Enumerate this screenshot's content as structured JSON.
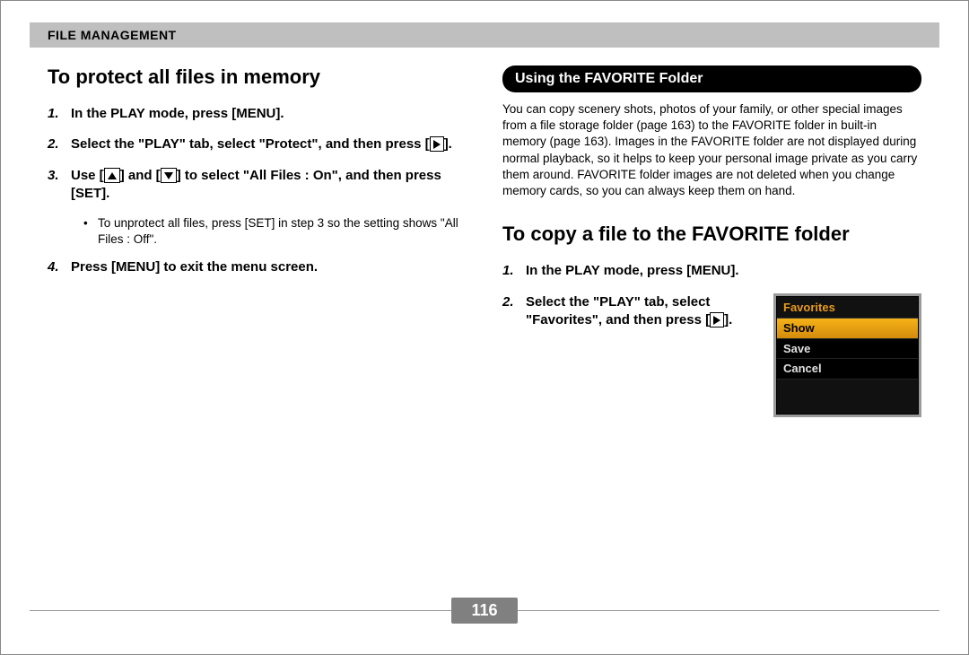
{
  "header": {
    "section": "File Management"
  },
  "left": {
    "heading": "To protect all files in memory",
    "steps": {
      "s1": "In the PLAY mode, press [MENU].",
      "s2_a": "Select the \"PLAY\" tab, select \"Protect\", and then press [",
      "s2_b": "].",
      "s3_a": "Use [",
      "s3_b": "] and [",
      "s3_c": "] to select \"All Files : On\", and then press [SET].",
      "bullet": "To unprotect all files, press [SET] in step 3 so the setting shows \"All Files : Off\".",
      "s4": "Press [MENU] to exit the menu screen."
    }
  },
  "right": {
    "pill": "Using the FAVORITE Folder",
    "intro": "You can copy scenery shots, photos of your family, or other special images from a file storage folder (page 163) to the FAVORITE folder in built-in memory (page 163). Images in the FAVORITE folder are not displayed during normal playback, so it helps to keep your personal image private as you carry them around. FAVORITE folder images are not deleted when you change memory cards, so you can always keep them on hand.",
    "heading2": "To copy a file to the FAVORITE folder",
    "steps": {
      "s1": "In the PLAY mode, press [MENU].",
      "s2_a": "Select the \"PLAY\" tab, select \"Favorites\", and then press [",
      "s2_b": "]."
    },
    "menu": {
      "title": "Favorites",
      "opt1": "Show",
      "opt2": "Save",
      "opt3": "Cancel"
    }
  },
  "footer": {
    "page_number": "116"
  }
}
